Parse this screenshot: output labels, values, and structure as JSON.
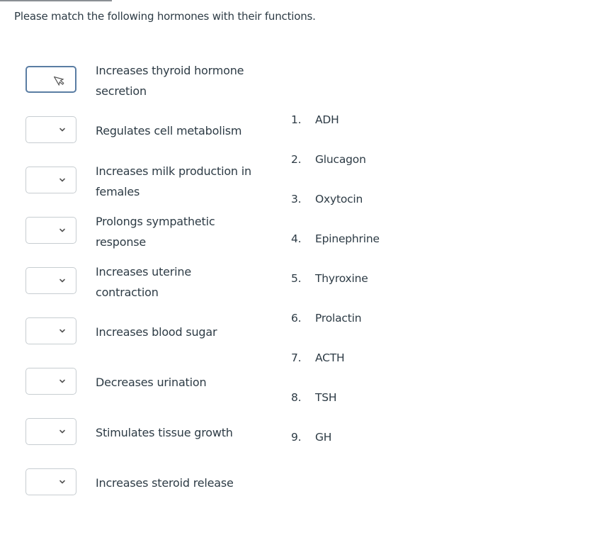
{
  "question": {
    "prompt": "Please match the following hormones with their functions."
  },
  "matches": [
    {
      "function": "Increases thyroid hormone secretion",
      "lines": [
        "Increases thyroid hormone",
        "secretion"
      ],
      "selected": "",
      "state": "focused"
    },
    {
      "function": "Regulates cell metabolism",
      "lines": [
        "Regulates cell metabolism"
      ],
      "selected": ""
    },
    {
      "function": "Increases milk production in females",
      "lines": [
        "Increases milk production in",
        "females"
      ],
      "selected": ""
    },
    {
      "function": "Prolongs sympathetic response",
      "lines": [
        "Prolongs sympathetic",
        "response"
      ],
      "selected": ""
    },
    {
      "function": "Increases uterine contraction",
      "lines": [
        "Increases uterine",
        "contraction"
      ],
      "selected": ""
    },
    {
      "function": "Increases blood sugar",
      "lines": [
        "Increases blood sugar"
      ],
      "selected": ""
    },
    {
      "function": "Decreases urination",
      "lines": [
        "Decreases urination"
      ],
      "selected": ""
    },
    {
      "function": "Stimulates tissue growth",
      "lines": [
        "Stimulates tissue growth"
      ],
      "selected": ""
    },
    {
      "function": "Increases steroid release",
      "lines": [
        "Increases steroid release"
      ],
      "selected": ""
    }
  ],
  "answers": [
    {
      "num": "1.",
      "label": "ADH"
    },
    {
      "num": "2.",
      "label": "Glucagon"
    },
    {
      "num": "3.",
      "label": "Oxytocin"
    },
    {
      "num": "4.",
      "label": "Epinephrine"
    },
    {
      "num": "5.",
      "label": "Thyroxine"
    },
    {
      "num": "6.",
      "label": "Prolactin"
    },
    {
      "num": "7.",
      "label": "ACTH"
    },
    {
      "num": "8.",
      "label": "TSH"
    },
    {
      "num": "9.",
      "label": "GH"
    }
  ],
  "colors": {
    "text": "#2d3b45",
    "select_border": "#c7cdd1",
    "focus_border": "#5a7da3"
  }
}
